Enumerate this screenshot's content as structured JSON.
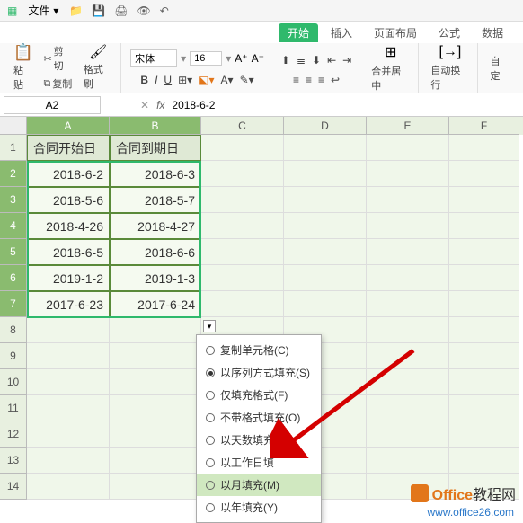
{
  "titlebar": {
    "file_menu": "文件",
    "icons": [
      "folder-icon",
      "save-icon",
      "print-icon",
      "preview-icon",
      "undo-icon",
      "redo-icon"
    ]
  },
  "tabs": {
    "start": "开始",
    "insert": "插入",
    "layout": "页面布局",
    "formula": "公式",
    "data": "数据"
  },
  "ribbon": {
    "paste": "粘贴",
    "cut": "剪切",
    "copy": "复制",
    "format_painter": "格式刷",
    "font_name": "宋体",
    "font_size": "16",
    "merge_center": "合并居中",
    "auto_wrap": "自动换行",
    "auto_settings": "自定"
  },
  "name_box": "A2",
  "formula_value": "2018-6-2",
  "columns": [
    "A",
    "B",
    "C",
    "D",
    "E",
    "F"
  ],
  "rows": [
    "1",
    "2",
    "3",
    "4",
    "5",
    "6",
    "7",
    "8",
    "9",
    "10",
    "11",
    "12",
    "13",
    "14"
  ],
  "headers": {
    "a": "合同开始日",
    "b": "合同到期日"
  },
  "data": [
    {
      "a": "2018-6-2",
      "b": "2018-6-3"
    },
    {
      "a": "2018-5-6",
      "b": "2018-5-7"
    },
    {
      "a": "2018-4-26",
      "b": "2018-4-27"
    },
    {
      "a": "2018-6-5",
      "b": "2018-6-6"
    },
    {
      "a": "2019-1-2",
      "b": "2019-1-3"
    },
    {
      "a": "2017-6-23",
      "b": "2017-6-24"
    }
  ],
  "menu": {
    "copy_cells": "复制单元格(C)",
    "fill_series": "以序列方式填充(S)",
    "fill_format_only": "仅填充格式(F)",
    "fill_without_format": "不带格式填充(O)",
    "fill_days": "以天数填充(D)",
    "fill_workdays": "以工作日填",
    "fill_months": "以月填充(M)",
    "fill_years": "以年填充(Y)"
  },
  "watermark": {
    "brand1": "Office",
    "brand2": "教程网",
    "url": "www.office26.com"
  }
}
